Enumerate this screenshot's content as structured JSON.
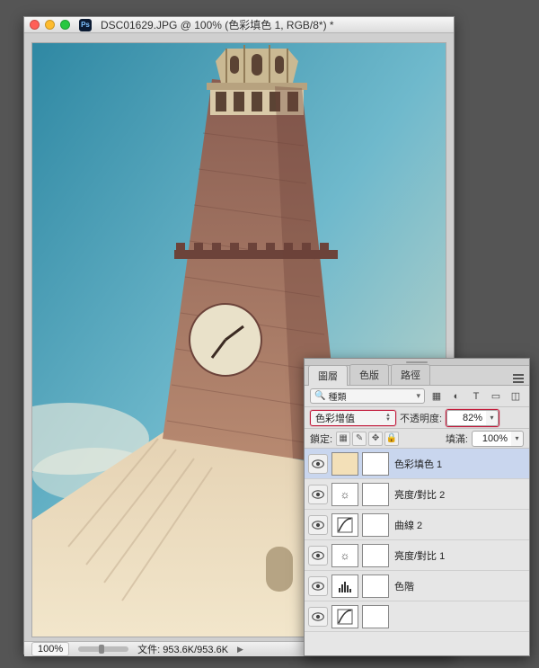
{
  "titlebar": {
    "title": "DSC01629.JPG @ 100% (色彩填色 1, RGB/8*) *",
    "ps_label": "Ps"
  },
  "statusbar": {
    "zoom": "100%",
    "file_info": "文件: 953.6K/953.6K"
  },
  "panel": {
    "tabs": [
      "圖層",
      "色版",
      "路徑"
    ],
    "filter_label": "種類",
    "blend_mode": "色彩增值",
    "opacity_label": "不透明度:",
    "opacity_value": "82%",
    "lock_label": "鎖定:",
    "fill_label": "填滿:",
    "fill_value": "100%",
    "layers": [
      {
        "name": "色彩填色 1",
        "selected": true,
        "type": "fill"
      },
      {
        "name": "亮度/對比 2",
        "selected": false,
        "type": "brightness"
      },
      {
        "name": "曲線 2",
        "selected": false,
        "type": "curves"
      },
      {
        "name": "亮度/對比 1",
        "selected": false,
        "type": "brightness"
      },
      {
        "name": "色階",
        "selected": false,
        "type": "levels"
      },
      {
        "name": "",
        "selected": false,
        "type": "curves"
      }
    ]
  }
}
